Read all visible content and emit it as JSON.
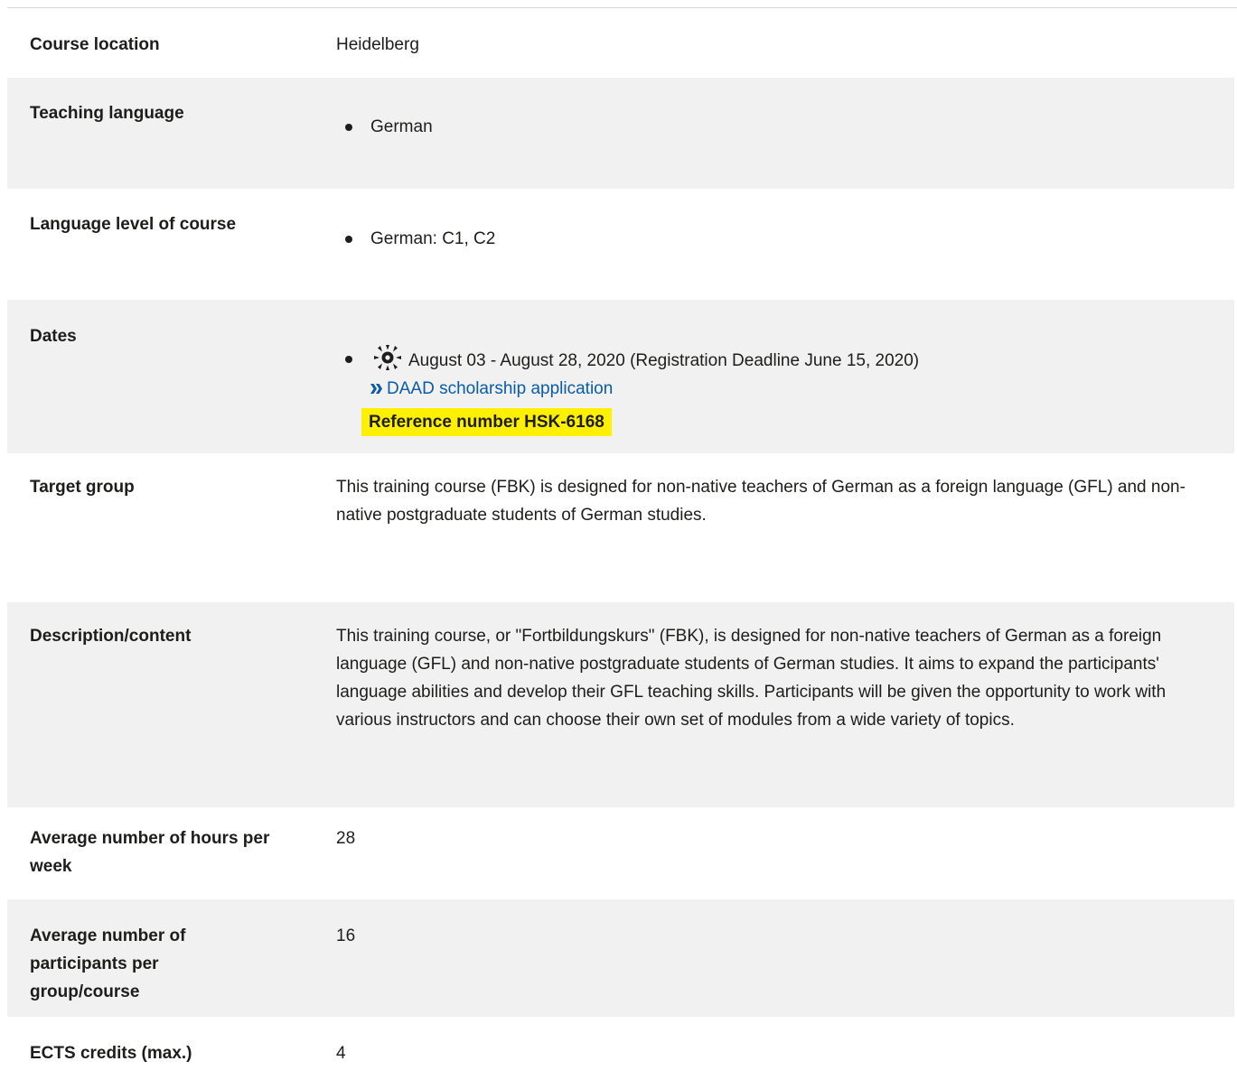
{
  "rows": [
    {
      "label": "Course location",
      "value": "Heidelberg"
    },
    {
      "label": "Teaching language",
      "items": [
        "German"
      ]
    },
    {
      "label": "Language level of course",
      "items": [
        "German: C1, C2"
      ]
    },
    {
      "label": "Dates",
      "date_text": "August 03 - August 28, 2020 (Registration Deadline June 15, 2020)",
      "season_icon": "sun-icon",
      "link_label": "DAAD scholarship application",
      "reference": "Reference number HSK-6168"
    },
    {
      "label": "Target group",
      "value": "This training course (FBK) is designed for non-native teachers of German as a foreign language (GFL) and non-native postgraduate students of German studies."
    },
    {
      "label": "Description/content",
      "value": "This training course, or \"Fortbildungskurs\" (FBK), is designed for non-native teachers of German as a foreign language (GFL) and non-native postgraduate students of German studies. It aims to expand the participants' language abilities and develop their GFL teaching skills. Participants will be given the opportunity to work with various instructors and can choose their own set of modules from a wide variety of topics."
    },
    {
      "label": "Average number of hours per week",
      "value": "28"
    },
    {
      "label": "Average number of participants per group/course",
      "value": "16"
    },
    {
      "label": "ECTS credits (max.)",
      "value": "4"
    }
  ],
  "colors": {
    "row_alt": "#f1f1f1",
    "link": "#0a5ba8",
    "highlight": "#fff000"
  }
}
